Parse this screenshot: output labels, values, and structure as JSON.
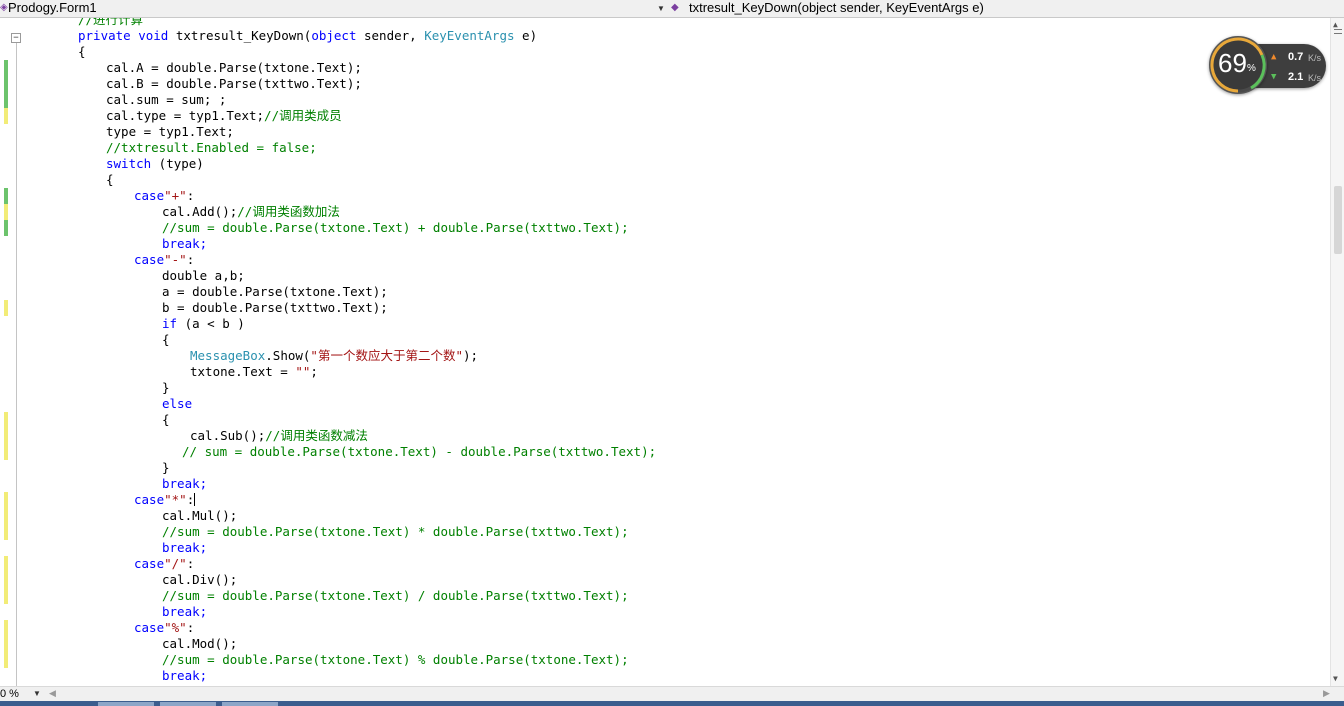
{
  "nav": {
    "class_dropdown": "Prodogy.Form1",
    "member_dropdown": "txtresult_KeyDown(object sender, KeyEventArgs e)"
  },
  "code": {
    "line0": "//进行计算",
    "line1_kw": "private void",
    "line1_name": " txtresult_KeyDown(",
    "line1_kw2": "object",
    "line1_mid": " sender, ",
    "line1_type": "KeyEventArgs",
    "line1_end": " e)",
    "line2": "{",
    "line3": "cal.A = double.Parse(txtone.Text);",
    "line4": "cal.B = double.Parse(txttwo.Text);",
    "line5": "cal.sum = sum; ;",
    "line6_code": "cal.type = typ1.Text;",
    "line6_comment": "//调用类成员",
    "line7": "type = typ1.Text;",
    "line8": "//txtresult.Enabled = false;",
    "line9_kw": "switch",
    "line9_rest": " (type)",
    "line10": "{",
    "line11_kw": "case",
    "line11_str": "\"+\"",
    "line11_end": ":",
    "line12_code": "cal.Add();",
    "line12_comment": "//调用类函数加法",
    "line13": "//sum = double.Parse(txtone.Text) + double.Parse(txttwo.Text);",
    "line14": "break;",
    "line15_kw": "case",
    "line15_str": "\"-\"",
    "line15_end": ":",
    "line16": "double a,b;",
    "line17": "a = double.Parse(txtone.Text);",
    "line18": "b = double.Parse(txttwo.Text);",
    "line19_kw": "if",
    "line19_rest": " (a < b )",
    "line20": "{",
    "line21_type": "MessageBox",
    "line21_mid": ".Show(",
    "line21_str": "\"第一个数应大于第二个数\"",
    "line21_end": ");",
    "line22_code": "txtone.Text = ",
    "line22_str": "\"\"",
    "line22_end": ";",
    "line23": "}",
    "line24": "else",
    "line25": "{",
    "line26_code": "cal.Sub();",
    "line26_comment": "//调用类函数减法",
    "line27": "// sum = double.Parse(txtone.Text) - double.Parse(txttwo.Text);",
    "line28": "}",
    "line29": "break;",
    "line30_kw": "case",
    "line30_str": "\"*\"",
    "line30_end": ":",
    "line31": "cal.Mul();",
    "line32": "//sum = double.Parse(txtone.Text) * double.Parse(txttwo.Text);",
    "line33": "break;",
    "line34_kw": "case",
    "line34_str": "\"/\"",
    "line34_end": ":",
    "line35": "cal.Div();",
    "line36": "//sum = double.Parse(txtone.Text) / double.Parse(txttwo.Text);",
    "line37": "break;",
    "line38_kw": "case",
    "line38_str": "\"%\"",
    "line38_end": ":",
    "line39": "cal.Mod();",
    "line40": "//sum = double.Parse(txtone.Text) % double.Parse(txtone.Text);",
    "line41": "break;"
  },
  "status": {
    "zoom": "0 %"
  },
  "net_widget": {
    "percent": "69",
    "percent_sign": "%",
    "upload_rate": "0.7",
    "upload_unit": "K/s",
    "download_rate": "2.1",
    "download_unit": "K/s"
  },
  "colors": {
    "keyword": "#0000ff",
    "type": "#2b91af",
    "comment": "#008000",
    "string": "#a31515",
    "change_saved": "#6cc36c",
    "change_unsaved": "#f2ec77"
  },
  "icons": {
    "class_icon": "class-icon",
    "method_icon": "method-icon"
  }
}
